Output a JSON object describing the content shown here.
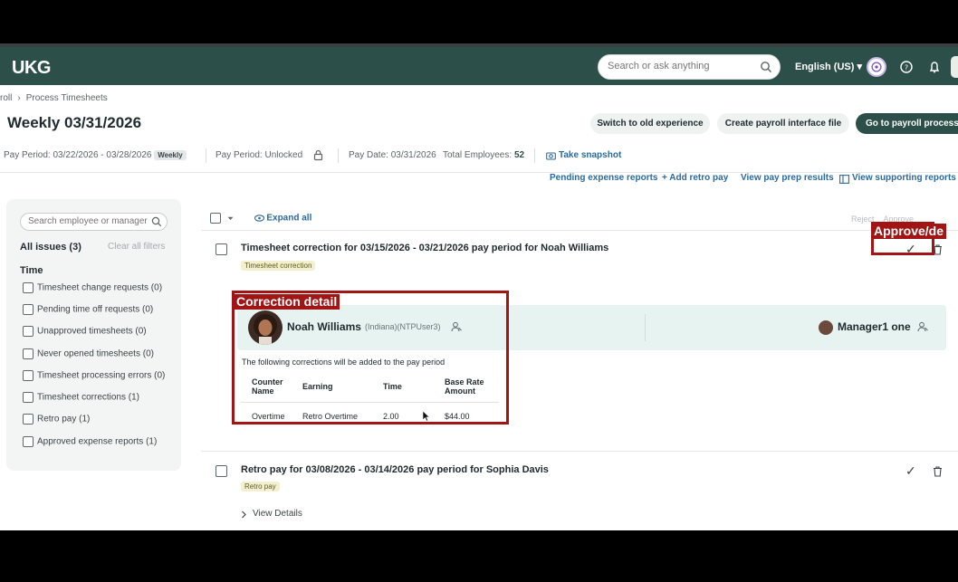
{
  "header": {
    "logo": "UKG",
    "search_placeholder": "Search or ask anything",
    "language": "English (US) ▾"
  },
  "breadcrumb": [
    "roll",
    "›",
    "Process Timesheets"
  ],
  "page": {
    "title": "Weekly 03/31/2026",
    "buttons": {
      "old_experience": "Switch to old experience",
      "create_interface": "Create payroll interface file",
      "go_processing": "Go to payroll processin"
    }
  },
  "meta": {
    "pay_period": "Pay Period: 03/22/2026 - 03/28/2026",
    "weekly_tag": "Weekly",
    "unlocked": "Pay Period: Unlocked",
    "pay_date": "Pay Date: 03/31/2026",
    "total_employees_label": "Total Employees:",
    "total_employees": "52",
    "snapshot": "Take snapshot"
  },
  "links": {
    "pending_expense": "Pending expense reports",
    "add_retro": "+ Add retro pay",
    "view_prep": "View pay prep results",
    "view_supporting": "View supporting reports"
  },
  "sidebar": {
    "search_placeholder": "Search employee or manager",
    "all_issues": "All issues (3)",
    "clear_filters": "Clear all filters",
    "section": "Time",
    "filters": [
      "Timesheet change requests (0)",
      "Pending time off requests (0)",
      "Unapproved timesheets (0)",
      "Never opened timesheets (0)",
      "Timesheet processing errors (0)",
      "Timesheet corrections (1)",
      "Retro pay (1)",
      "Approved expense reports (1)"
    ]
  },
  "list": {
    "expand_all": "Expand all",
    "reject": "Reject",
    "approve": "Approve",
    "item1": {
      "title": "Timesheet correction for 03/15/2026 - 03/21/2026 pay period for Noah Williams",
      "tag": "Timesheet correction",
      "employee_name": "Noah Williams",
      "employee_sub": "(Indiana)(NTPUser3)",
      "manager_name": "Manager1 one",
      "correction_text": "The following corrections will be added to the pay period",
      "table": {
        "headers": [
          "Counter Name",
          "Earning",
          "Time",
          "Base Rate Amount"
        ],
        "rows": [
          [
            "Overtime",
            "Retro Overtime",
            "2.00",
            "$44.00"
          ]
        ]
      }
    },
    "item2": {
      "title": "Retro pay for 03/08/2026 - 03/14/2026 pay period for Sophia Davis",
      "tag": "Retro pay",
      "view_details": "View Details"
    }
  },
  "annotations": {
    "correction": "Correction detail",
    "approve": "Approve/de"
  },
  "colors": {
    "brand": "#2d4f4a",
    "link": "#2a6aa0",
    "annotation": "#a11515"
  }
}
